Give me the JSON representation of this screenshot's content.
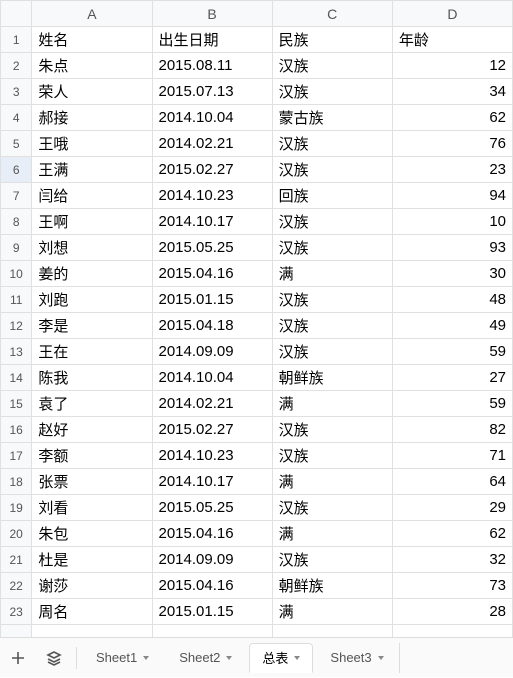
{
  "columns": [
    "A",
    "B",
    "C",
    "D"
  ],
  "headers": {
    "A": "姓名",
    "B": "出生日期",
    "C": "民族",
    "D": "年龄"
  },
  "rows": [
    {
      "A": "朱点",
      "B": "2015.08.11",
      "C": "汉族",
      "D": 12
    },
    {
      "A": "荣人",
      "B": "2015.07.13",
      "C": "汉族",
      "D": 34
    },
    {
      "A": "郝接",
      "B": "2014.10.04",
      "C": "蒙古族",
      "D": 62
    },
    {
      "A": "王哦",
      "B": "2014.02.21",
      "C": "汉族",
      "D": 76
    },
    {
      "A": "王满",
      "B": "2015.02.27",
      "C": "汉族",
      "D": 23
    },
    {
      "A": "闫给",
      "B": "2014.10.23",
      "C": "回族",
      "D": 94
    },
    {
      "A": "王啊",
      "B": "2014.10.17",
      "C": "汉族",
      "D": 10
    },
    {
      "A": "刘想",
      "B": "2015.05.25",
      "C": "汉族",
      "D": 93
    },
    {
      "A": "姜的",
      "B": "2015.04.16",
      "C": "满",
      "D": 30
    },
    {
      "A": "刘跑",
      "B": "2015.01.15",
      "C": "汉族",
      "D": 48
    },
    {
      "A": "李是",
      "B": "2015.04.18",
      "C": "汉族",
      "D": 49
    },
    {
      "A": "王在",
      "B": "2014.09.09",
      "C": "汉族",
      "D": 59
    },
    {
      "A": "陈我",
      "B": "2014.10.04",
      "C": "朝鲜族",
      "D": 27
    },
    {
      "A": "袁了",
      "B": "2014.02.21",
      "C": "满",
      "D": 59
    },
    {
      "A": "赵好",
      "B": "2015.02.27",
      "C": "汉族",
      "D": 82
    },
    {
      "A": "李额",
      "B": "2014.10.23",
      "C": "汉族",
      "D": 71
    },
    {
      "A": "张票",
      "B": "2014.10.17",
      "C": "满",
      "D": 64
    },
    {
      "A": "刘看",
      "B": "2015.05.25",
      "C": "汉族",
      "D": 29
    },
    {
      "A": "朱包",
      "B": "2015.04.16",
      "C": "满",
      "D": 62
    },
    {
      "A": "杜是",
      "B": "2014.09.09",
      "C": "汉族",
      "D": 32
    },
    {
      "A": "谢莎",
      "B": "2015.04.16",
      "C": "朝鲜族",
      "D": 73
    },
    {
      "A": "周名",
      "B": "2015.01.15",
      "C": "满",
      "D": 28
    }
  ],
  "selected_row_index": 4,
  "tabs": {
    "items": [
      {
        "label": "Sheet1",
        "active": false
      },
      {
        "label": "Sheet2",
        "active": false
      },
      {
        "label": "总表",
        "active": true
      },
      {
        "label": "Sheet3",
        "active": false
      }
    ]
  },
  "icons": {
    "add": "add-sheet-icon",
    "allsheets": "all-sheets-icon"
  }
}
